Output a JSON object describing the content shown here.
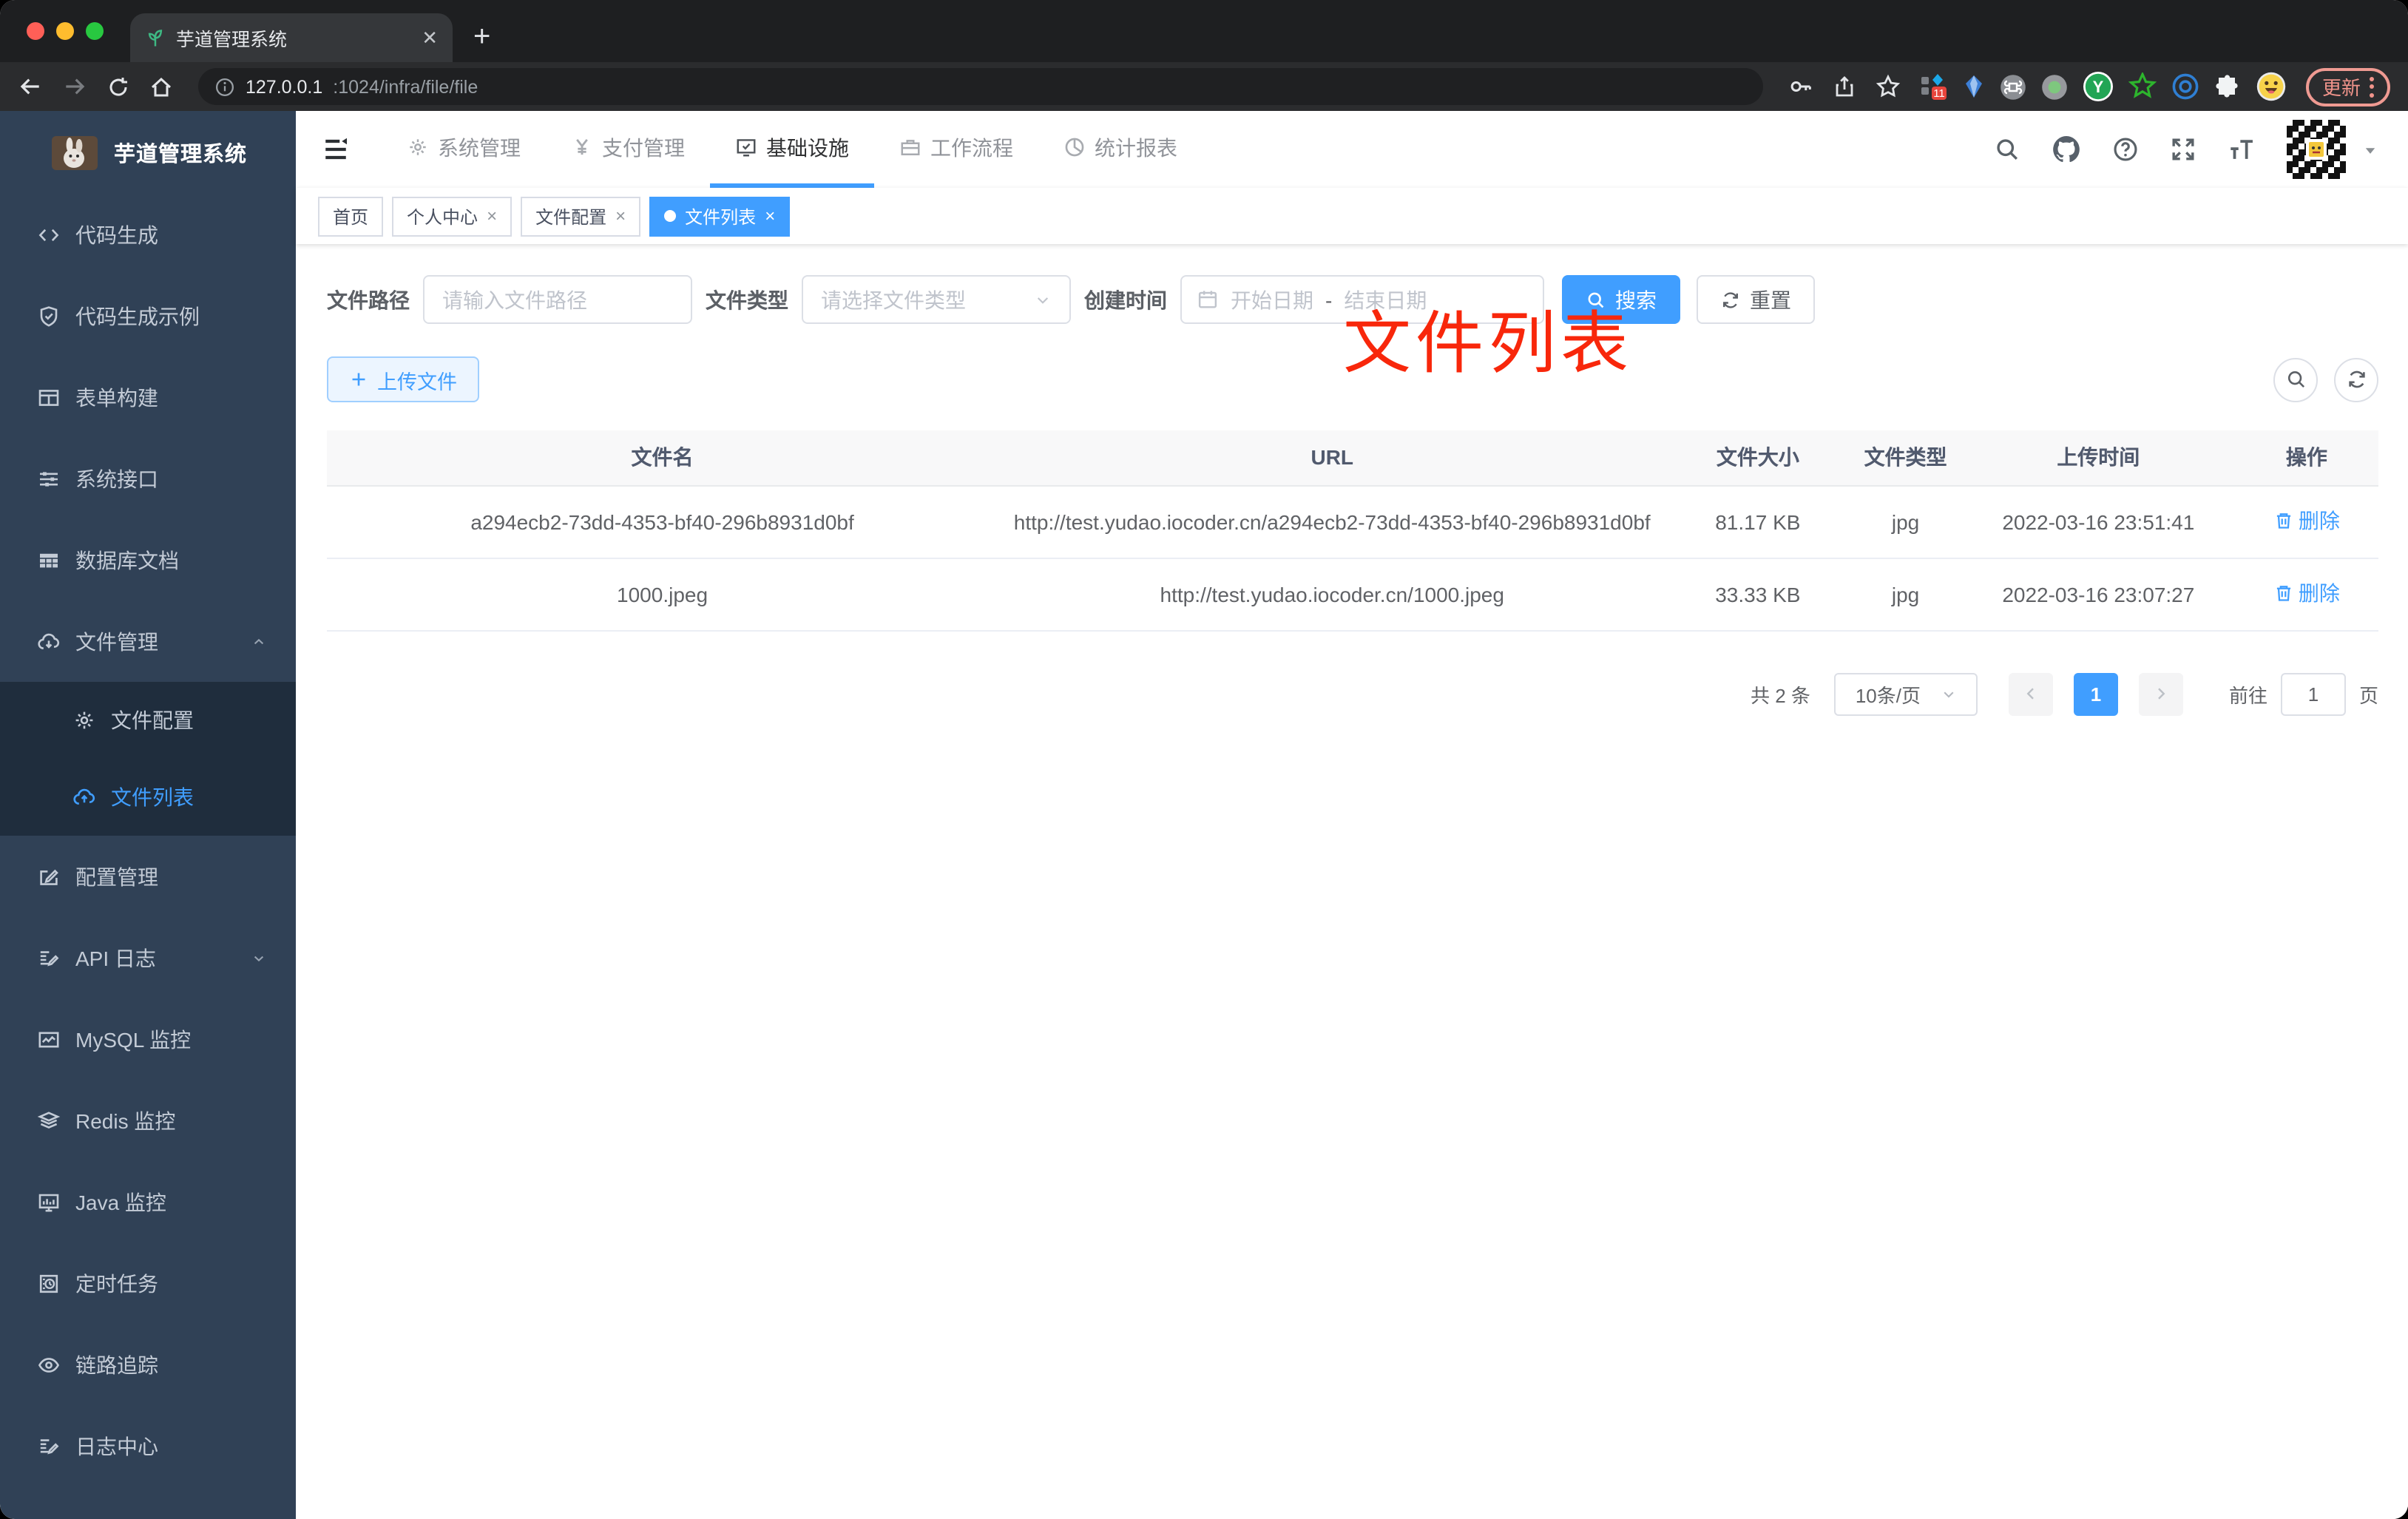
{
  "browser": {
    "traffic_lights": [
      "#ff5f57",
      "#febc2e",
      "#28c840"
    ],
    "tab": {
      "title": "芋道管理系统",
      "close": "✕"
    },
    "new_tab": "+",
    "url_host": "127.0.0.1",
    "url_path": ":1024/infra/file/file",
    "extensions": [
      "pin-grid",
      "balloon",
      "command",
      "record",
      "yudao-y",
      "green-star",
      "blue-eye",
      "puzzle",
      "emoji"
    ],
    "extension_badge": "11",
    "update_button": "更新"
  },
  "app": {
    "logo_title": "芋道管理系统",
    "sidebar": {
      "items": [
        {
          "label": "代码生成",
          "icon": "code"
        },
        {
          "label": "代码生成示例",
          "icon": "shield-check"
        },
        {
          "label": "表单构建",
          "icon": "form-grid"
        },
        {
          "label": "系统接口",
          "icon": "sliders"
        },
        {
          "label": "数据库文档",
          "icon": "table-solid"
        },
        {
          "label": "文件管理",
          "icon": "cloud-download",
          "chevron": "up"
        },
        {
          "label": "文件配置",
          "icon": "gear",
          "submenu": true
        },
        {
          "label": "文件列表",
          "icon": "cloud-upload",
          "submenu": true,
          "active": true
        },
        {
          "label": "配置管理",
          "icon": "edit"
        },
        {
          "label": "API 日志",
          "icon": "log-edit",
          "chevron": "down"
        },
        {
          "label": "MySQL 监控",
          "icon": "chart-line"
        },
        {
          "label": "Redis 监控",
          "icon": "layers"
        },
        {
          "label": "Java 监控",
          "icon": "monitor-bars"
        },
        {
          "label": "定时任务",
          "icon": "timer"
        },
        {
          "label": "链路追踪",
          "icon": "eye"
        },
        {
          "label": "日志中心",
          "icon": "log"
        }
      ]
    },
    "topnav": {
      "items": [
        {
          "label": "系统管理",
          "icon": "gear"
        },
        {
          "label": "支付管理",
          "icon": "yen"
        },
        {
          "label": "基础设施",
          "icon": "monitor-check",
          "active": true
        },
        {
          "label": "工作流程",
          "icon": "briefcase"
        },
        {
          "label": "统计报表",
          "icon": "pie"
        }
      ]
    },
    "tags": [
      {
        "label": "首页"
      },
      {
        "label": "个人中心",
        "closable": true
      },
      {
        "label": "文件配置",
        "closable": true
      },
      {
        "label": "文件列表",
        "closable": true,
        "active": true
      }
    ],
    "annotation": "文件列表",
    "annotation_color": "#f8270b",
    "filter": {
      "path_label": "文件路径",
      "path_placeholder": "请输入文件路径",
      "type_label": "文件类型",
      "type_placeholder": "请选择文件类型",
      "time_label": "创建时间",
      "start_placeholder": "开始日期",
      "range_separator": "-",
      "end_placeholder": "结束日期",
      "search_label": "搜索",
      "reset_label": "重置"
    },
    "toolbar": {
      "upload_label": "上传文件"
    },
    "table": {
      "headers": [
        "文件名",
        "URL",
        "文件大小",
        "文件类型",
        "上传时间",
        "操作"
      ],
      "col_widths": [
        "32.7%",
        "32.6%",
        "8.9%",
        "5.5%",
        "13.3%",
        "7%"
      ],
      "rows": [
        {
          "name": "a294ecb2-73dd-4353-bf40-296b8931d0bf",
          "url": "http://test.yudao.iocoder.cn/a294ecb2-73dd-4353-bf40-296b8931d0bf",
          "size": "81.17 KB",
          "type": "jpg",
          "time": "2022-03-16 23:51:41",
          "action": "删除"
        },
        {
          "name": "1000.jpeg",
          "url": "http://test.yudao.iocoder.cn/1000.jpeg",
          "size": "33.33 KB",
          "type": "jpg",
          "time": "2022-03-16 23:07:27",
          "action": "删除"
        }
      ]
    },
    "pagination": {
      "total": "共 2 条",
      "page_size": "10条/页",
      "current_page": "1",
      "goto_label": "前往",
      "goto_value": "1",
      "page_unit": "页"
    },
    "colors": {
      "primary": "#409eff",
      "sidebar_bg": "#304156",
      "submenu_bg": "#1f2d3d"
    }
  }
}
